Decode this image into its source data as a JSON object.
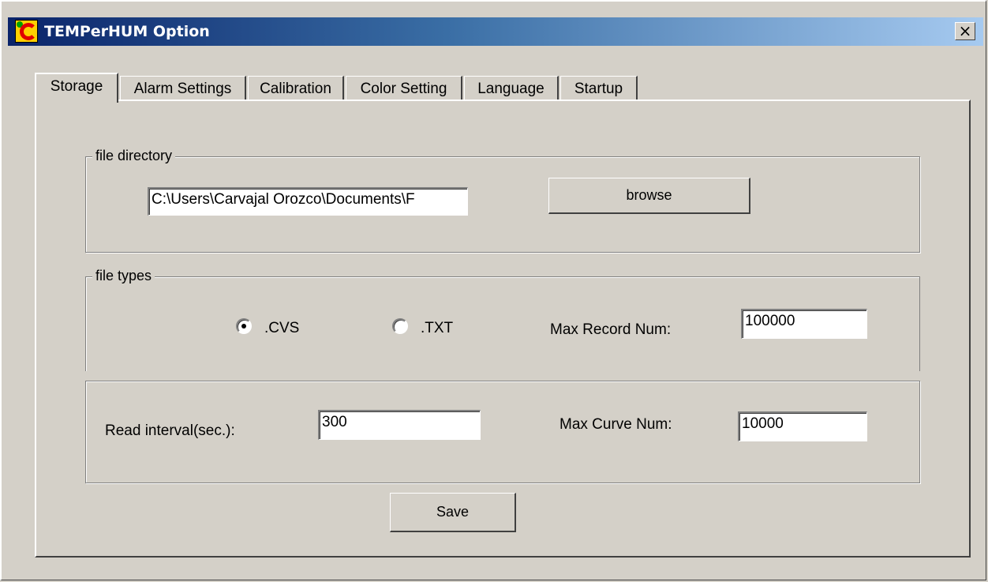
{
  "window": {
    "title": "TEMPerHUM Option",
    "close_label": "×"
  },
  "tabs": [
    {
      "label": "Storage",
      "active": true
    },
    {
      "label": "Alarm Settings",
      "active": false
    },
    {
      "label": "Calibration",
      "active": false
    },
    {
      "label": "Color Setting",
      "active": false
    },
    {
      "label": "Language",
      "active": false
    },
    {
      "label": "Startup",
      "active": false
    }
  ],
  "file_directory": {
    "legend": "file directory",
    "path_value": "C:\\Users\\Carvajal Orozco\\Documents\\F",
    "browse_label": "browse"
  },
  "file_types": {
    "legend": "file types",
    "options": [
      {
        "label": ".CVS",
        "selected": true
      },
      {
        "label": ".TXT",
        "selected": false
      }
    ],
    "max_record_label": "Max Record Num:",
    "max_record_value": "100000"
  },
  "intervals": {
    "read_interval_label": "Read interval(sec.):",
    "read_interval_value": "300",
    "max_curve_label": "Max Curve Num:",
    "max_curve_value": "10000"
  },
  "save_label": "Save"
}
